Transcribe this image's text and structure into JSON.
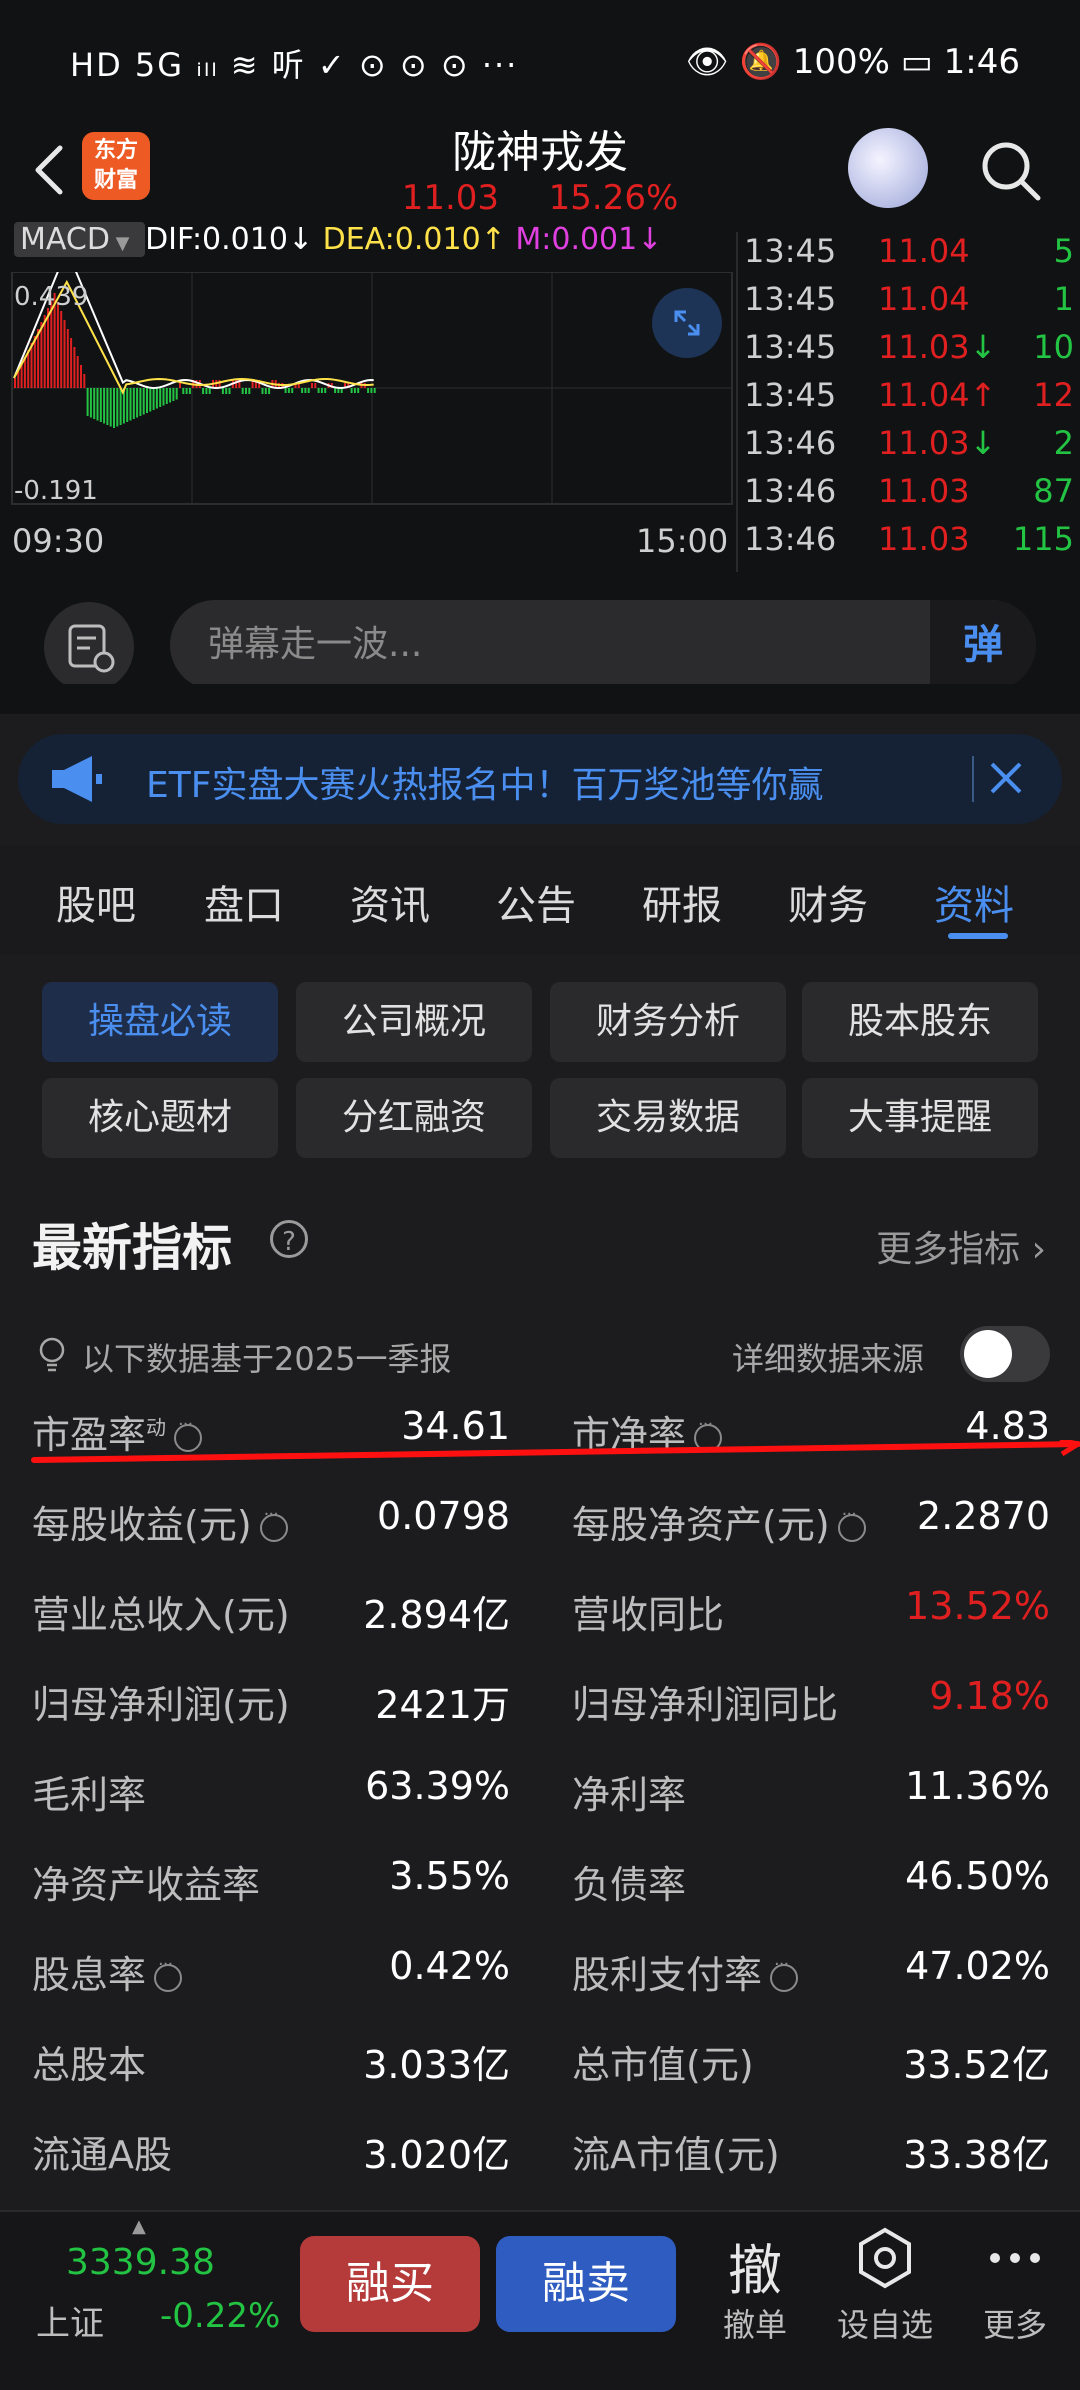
{
  "status_bar": {
    "left_text": "HD 5G ᵢₗₗ ≋ 听 ✓ ⊙ ⊙ ⊙ ···",
    "right_text": "👁 🔕 100% ▭ 1:46"
  },
  "header": {
    "logo_line1": "东方",
    "logo_line2": "财富",
    "stock_name": "陇神戎发",
    "price": "11.03",
    "change_pct": "15.26%"
  },
  "chart": {
    "indicator": "MACD",
    "dif": "DIF:0.010",
    "dea": "DEA:0.010",
    "m": "M:0.001",
    "max_label": "0.439",
    "min_label": "-0.191",
    "time_start": "09:30",
    "time_end": "15:00"
  },
  "ticks": [
    {
      "time": "13:45",
      "price": "11.04",
      "arrow": "",
      "vol": "5"
    },
    {
      "time": "13:45",
      "price": "11.04",
      "arrow": "",
      "vol": "1"
    },
    {
      "time": "13:45",
      "price": "11.03",
      "arrow": "↓",
      "vol": "10"
    },
    {
      "time": "13:45",
      "price": "11.04",
      "arrow": "↑",
      "vol": "12"
    },
    {
      "time": "13:46",
      "price": "11.03",
      "arrow": "↓",
      "vol": "2"
    },
    {
      "time": "13:46",
      "price": "11.03",
      "arrow": "",
      "vol": "87"
    },
    {
      "time": "13:46",
      "price": "11.03",
      "arrow": "",
      "vol": "115"
    }
  ],
  "danmu": {
    "placeholder": "弹幕走一波...",
    "send_label": "弹"
  },
  "banner": {
    "text": "ETF实盘大赛火热报名中！百万奖池等你赢"
  },
  "tabs": [
    "股吧",
    "盘口",
    "资讯",
    "公告",
    "研报",
    "财务",
    "资料"
  ],
  "active_tab": "资料",
  "sub_buttons": [
    "操盘必读",
    "公司概况",
    "财务分析",
    "股本股东",
    "核心题材",
    "分红融资",
    "交易数据",
    "大事提醒"
  ],
  "active_sub_button": "操盘必读",
  "metrics": {
    "section_title": "最新指标",
    "more_label": "更多指标 ›",
    "basis_text": "以下数据基于2025一季报",
    "source_label": "详细数据来源",
    "dynamic_mark": "动",
    "rows": [
      {
        "l_label": "市盈率",
        "l_val": "34.61",
        "r_label": "市净率",
        "r_val": "4.83"
      },
      {
        "l_label": "每股收益(元)",
        "l_val": "0.0798",
        "r_label": "每股净资产(元)",
        "r_val": "2.2870"
      },
      {
        "l_label": "营业总收入(元)",
        "l_val": "2.894亿",
        "r_label": "营收同比",
        "r_val": "13.52%"
      },
      {
        "l_label": "归母净利润(元)",
        "l_val": "2421万",
        "r_label": "归母净利润同比",
        "r_val": "9.18%"
      },
      {
        "l_label": "毛利率",
        "l_val": "63.39%",
        "r_label": "净利率",
        "r_val": "11.36%"
      },
      {
        "l_label": "净资产收益率",
        "l_val": "3.55%",
        "r_label": "负债率",
        "r_val": "46.50%"
      },
      {
        "l_label": "股息率",
        "l_val": "0.42%",
        "r_label": "股利支付率",
        "r_val": "47.02%"
      },
      {
        "l_label": "总股本",
        "l_val": "3.033亿",
        "r_label": "总市值(元)",
        "r_val": "33.52亿"
      },
      {
        "l_label": "流通A股",
        "l_val": "3.020亿",
        "r_label": "流A市值(元)",
        "r_val": "33.38亿"
      }
    ]
  },
  "bottom": {
    "index_value": "3339.38",
    "index_name": "上证",
    "index_change": "-0.22%",
    "buy_label": "融买",
    "sell_label": "融卖",
    "cancel_big": "撤",
    "cancel_label": "撤单",
    "fav_label": "设自选",
    "more_label": "更多"
  },
  "colors": {
    "up": "#e02020",
    "down": "#23c343",
    "accent": "#4a8ff0",
    "background": "#1c1c1e"
  }
}
